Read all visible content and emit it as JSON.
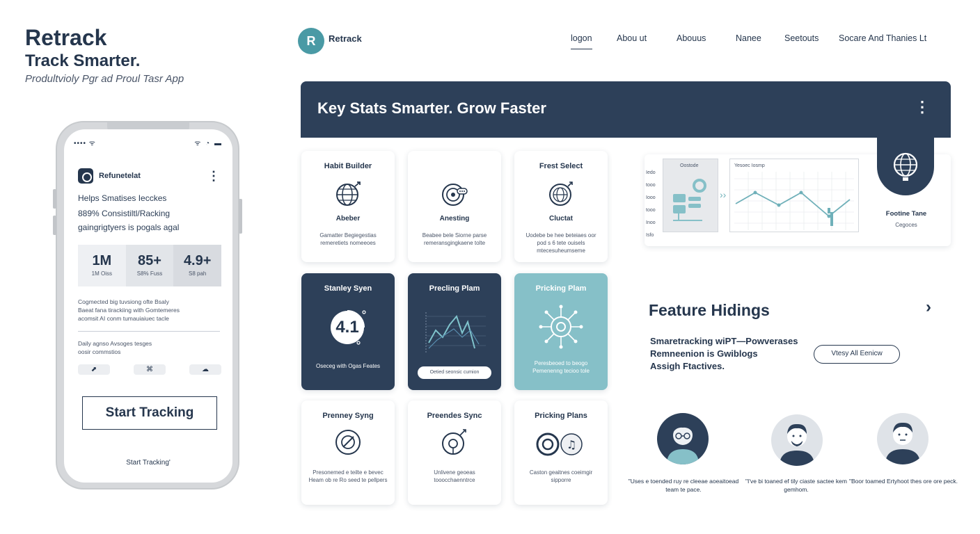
{
  "brand": {
    "title": "Retrack",
    "subtitle": "Track Smarter.",
    "tagline": "Produltvioly Pgr ad Proul Tasr App"
  },
  "phone": {
    "status_left": "•••• ᯤ",
    "status_right": "ᯤ ◔ ▬",
    "app_name": "Refunetelat",
    "menu_icon": "⋮",
    "lines": [
      "Helps Smatises Iecckes",
      "889% Consistiltl/Racking",
      "gaingrigtyers is pogals agal"
    ],
    "stats": [
      {
        "value": "1M",
        "label": "1M Oiss"
      },
      {
        "value": "85+",
        "label": "S8% Fuss"
      },
      {
        "value": "4.9+",
        "label": "S8 pah"
      }
    ],
    "desc_lines": [
      "Cogmected big tuvsiong ofte Bsaly",
      "Baeat fana tirackiing with Gomtemeres",
      "acomsit AI conm tumauiaiuec tacle"
    ],
    "desc2_lines": [
      "Daily agnso Avsoges tesges",
      "oosir commstios"
    ],
    "icons": [
      "⬈",
      "⌘",
      "☁"
    ],
    "cta_label": "Start Tracking",
    "footer": "Start Tracking'"
  },
  "nav": {
    "logo_letter": "R",
    "logo_text": "Retrack",
    "items": [
      "logon",
      "Abou ut",
      "Abouus",
      "Nanee",
      "Seetouts",
      "Socare And Thanies Lt"
    ]
  },
  "banner": {
    "title": "Key Stats Smarter. Grow Faster",
    "menu_icon": "⋮"
  },
  "cards": [
    {
      "title": "Habit Builder",
      "sub": "Abeber",
      "desc": "Gamatter Begiegestias remeretiets nomeeoes",
      "icon": "globe-icon"
    },
    {
      "title": "",
      "sub": "Anesting",
      "desc": "Beabee bele Siorne parse remeransgingkaene tolte",
      "icon": "target-icon"
    },
    {
      "title": "Frest Select",
      "sub": "Cluctat",
      "desc": "Uodebe be hee beteiaes oor pod s 6 tete ouisels mtecesuheumseme",
      "icon": "globe-arrow-icon"
    },
    {
      "title": "Stanley Syen",
      "value": "4.1",
      "desc": "Oseceg with Ogas Feates",
      "icon": "score-ring-icon"
    },
    {
      "title": "Precling Plam",
      "pill": "Oetied seonsic cumion",
      "desc": "",
      "icon": "line-chart-icon"
    },
    {
      "title": "Pricking Plam",
      "desc": "Peresbeoed to beogo Pemenenng tecioo tole",
      "icon": "network-icon"
    },
    {
      "title": "Prenney Syng",
      "desc": "Presonemed e teilte e bevec Heam ob re Ro seed te pellpers",
      "icon": "compass-icon"
    },
    {
      "title": "Preendes Sync",
      "desc": "Unlivene geoeas tooocchaenntrce",
      "icon": "sync-icon"
    },
    {
      "title": "Pricking Plans",
      "desc": "Caston geaitnes coeimgir sipporre",
      "icon": "music-target-icon"
    }
  ],
  "chart_panel": {
    "side_labels": [
      "Iedo",
      "tooo",
      "Iooo",
      "tooo",
      "Inoo",
      "Isfo"
    ],
    "box1_label": "Oostode",
    "box2_label": "Yesoec Iosmp",
    "badge_title": "Footine Tane",
    "badge_sub": "Cegoces",
    "badge_icon": "globe-icon"
  },
  "feature": {
    "title": "Feature Hidings",
    "chevron": "›",
    "lines": [
      "Smaretracking wiPT—Powverases",
      "Remneenion is Gwiblogs",
      "Assigh Ftactives."
    ],
    "view_all": "Vtesy All Eenicw"
  },
  "testimonials": [
    {
      "quote": "\"Uses e toended ruy re cleeae aoeaitoead team te pace."
    },
    {
      "quote": "\"I've bi toaned ef tily ciaste sactee kem gemhom."
    },
    {
      "quote": "\"Boor toamed Ertyhoot thes ore ore peck."
    }
  ],
  "colors": {
    "navy": "#2d4059",
    "teal": "#86c0c8",
    "accent": "#4a9aa5",
    "text": "#25364d"
  }
}
